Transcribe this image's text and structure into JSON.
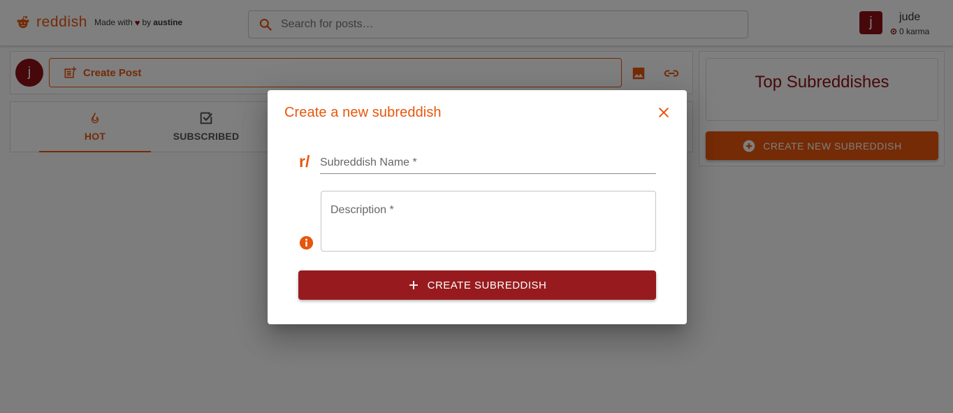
{
  "navbar": {
    "brand_name": "reddish",
    "made_with_prefix": "Made with",
    "made_with_by": "by",
    "author": "austine",
    "search_placeholder": "Search for posts…"
  },
  "user": {
    "avatar_letter": "j",
    "name": "jude",
    "karma": "0 karma"
  },
  "create_post": {
    "avatar_letter": "j",
    "label": "Create Post"
  },
  "tabs": [
    {
      "label": "HOT",
      "active": true
    },
    {
      "label": "SUBSCRIBED",
      "active": false
    }
  ],
  "sidebar": {
    "top_title": "Top Subreddishes",
    "new_button": "CREATE NEW SUBREDDISH"
  },
  "dialog": {
    "title": "Create a new subreddish",
    "prefix": "r/",
    "name_placeholder": "Subreddish Name *",
    "description_placeholder": "Description *",
    "submit_label": "CREATE SUBREDDISH"
  },
  "colors": {
    "accent": "#e8560c",
    "primary": "#971b1e",
    "backdrop": "rgba(0,0,0,0.5)"
  }
}
